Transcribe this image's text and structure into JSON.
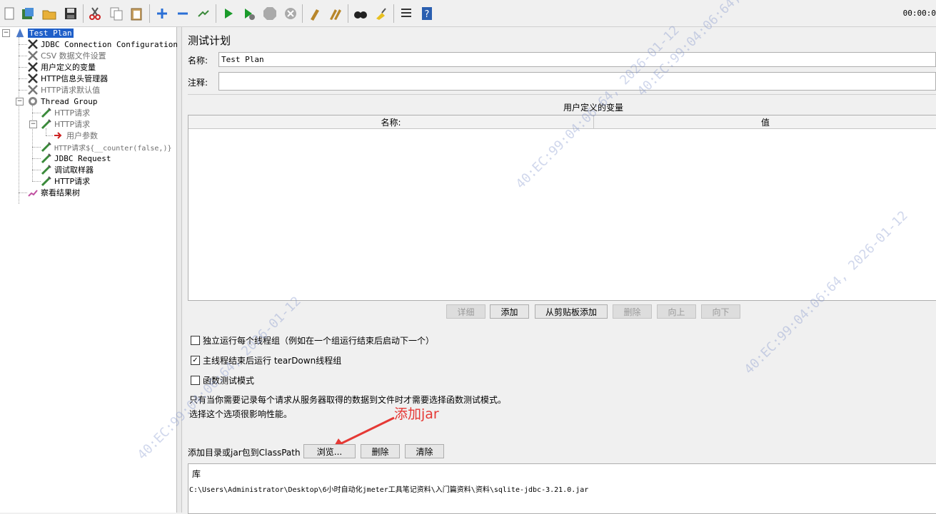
{
  "toolbar": {
    "icons": [
      "new-icon",
      "templates-icon",
      "open-icon",
      "save-icon",
      "cut-icon",
      "copy-icon",
      "paste-icon",
      "expand-icon",
      "collapse-icon",
      "toggle-icon",
      "start-icon",
      "start-no-pause-icon",
      "stop-icon",
      "shutdown-icon",
      "clear-icon",
      "clear-all-icon",
      "search-icon",
      "reset-search-icon",
      "function-helper-icon",
      "help-icon"
    ],
    "timer": "00:00:0"
  },
  "tree": {
    "nodes": [
      {
        "label": "Test Plan",
        "icon": "test-plan-icon",
        "selected": true
      },
      {
        "label": "JDBC Connection Configuration",
        "icon": "config-wrench-icon"
      },
      {
        "label": "CSV 数据文件设置",
        "icon": "config-wrench-icon",
        "disabled": true
      },
      {
        "label": "用户定义的变量",
        "icon": "config-wrench-icon"
      },
      {
        "label": "HTTP信息头管理器",
        "icon": "config-wrench-icon"
      },
      {
        "label": "HTTP请求默认值",
        "icon": "config-wrench-icon",
        "disabled": true
      },
      {
        "label": "Thread Group",
        "icon": "thread-group-icon"
      },
      {
        "label": "HTTP请求",
        "icon": "sampler-pipette-icon",
        "disabled": true
      },
      {
        "label": "HTTP请求",
        "icon": "sampler-pipette-icon",
        "disabled": true
      },
      {
        "label": "用户参数",
        "icon": "pre-processor-icon",
        "disabled": true
      },
      {
        "label": "HTTP请求${__counter(false,)}",
        "icon": "sampler-pipette-icon",
        "disabled": true
      },
      {
        "label": "JDBC Request",
        "icon": "sampler-pipette-icon"
      },
      {
        "label": "调试取样器",
        "icon": "sampler-pipette-icon"
      },
      {
        "label": "HTTP请求",
        "icon": "sampler-pipette-icon"
      },
      {
        "label": "察看结果树",
        "icon": "listener-icon"
      }
    ]
  },
  "panel": {
    "title": "测试计划",
    "name_label": "名称:",
    "name_value": "Test Plan",
    "comment_label": "注释:",
    "comment_value": "",
    "vars_title": "用户定义的变量",
    "col_name": "名称:",
    "col_value": "值",
    "buttons": {
      "detail": "详细",
      "add": "添加",
      "add_clipboard": "从剪贴板添加",
      "delete": "删除",
      "up": "向上",
      "down": "向下"
    },
    "check_serial": "独立运行每个线程组（例如在一个组运行结束后启动下一个）",
    "check_teardown": "主线程结束后运行 tearDown线程组",
    "check_functional": "函数测试模式",
    "info_line1": "只有当你需要记录每个请求从服务器取得的数据到文件时才需要选择函数测试模式。",
    "info_line2": "选择这个选项很影响性能。",
    "classpath_label": "添加目录或jar包到ClassPath",
    "browse": "浏览...",
    "cp_delete": "删除",
    "cp_clear": "清除",
    "lib_header": "库",
    "lib_path": "C:\\Users\\Administrator\\Desktop\\6小时自动化jmeter工具笔记资料\\入门篇资料\\资料\\sqlite-jdbc-3.21.0.jar"
  },
  "annotation": {
    "text": "添加jar",
    "color": "#e53935"
  },
  "watermarks": [
    "40:EC:99:04:06:64, 2026-01-12",
    "40:EC:99:04:06:64, 2026-01-12",
    "40:EC:99:04:06:64, 2026-01-12",
    "40:EC:99:04:06:64, 2026-01-12"
  ],
  "checks": {
    "serial": false,
    "teardown": true,
    "functional": false
  }
}
